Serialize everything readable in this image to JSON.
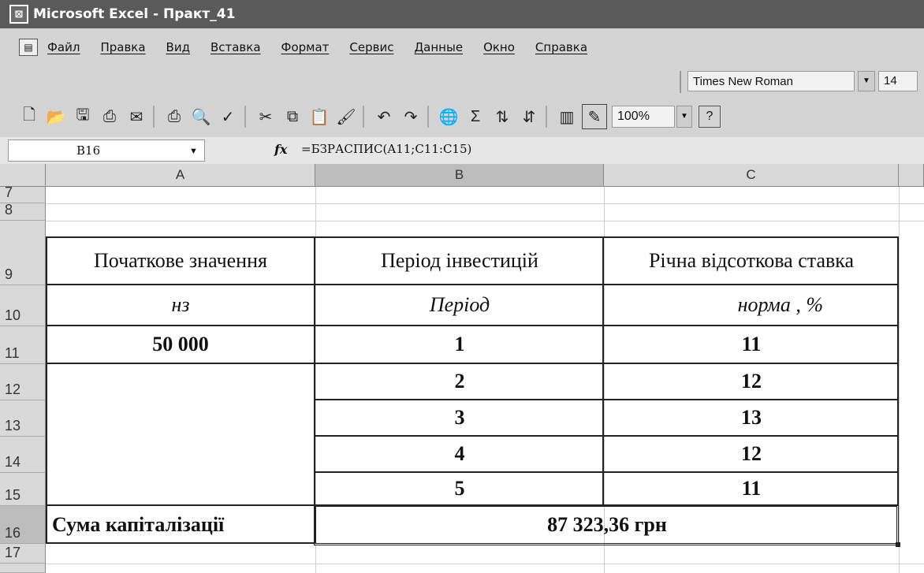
{
  "window": {
    "title": "Microsoft Excel - Практ_41"
  },
  "menu": [
    "Файл",
    "Правка",
    "Вид",
    "Вставка",
    "Формат",
    "Сервис",
    "Данные",
    "Окно",
    "Справка"
  ],
  "format_toolbar": {
    "font_name": "Times New Roman",
    "font_size": "14"
  },
  "standard_toolbar": {
    "zoom": "100%",
    "help": "?"
  },
  "formula_bar": {
    "cell_ref": "B16",
    "fx": "fx",
    "formula": "=БЗРАСПИС(A11;C11:C15)"
  },
  "columns": [
    "A",
    "B",
    "C"
  ],
  "rows": [
    "7",
    "8",
    "9",
    "10",
    "11",
    "12",
    "13",
    "14",
    "15",
    "16",
    "17"
  ],
  "table": {
    "headers": [
      "Початкове значення",
      "Період інвестицій",
      "Річна відсоткова ставка"
    ],
    "subheaders": [
      "нз",
      "Період",
      "норма , %"
    ],
    "initial_value": "50 000",
    "periods": [
      "1",
      "2",
      "3",
      "4",
      "5"
    ],
    "rates": [
      "11",
      "12",
      "13",
      "12",
      "11"
    ],
    "total_label": "Сума капіталізації",
    "total_value": "87 323,36 грн"
  }
}
